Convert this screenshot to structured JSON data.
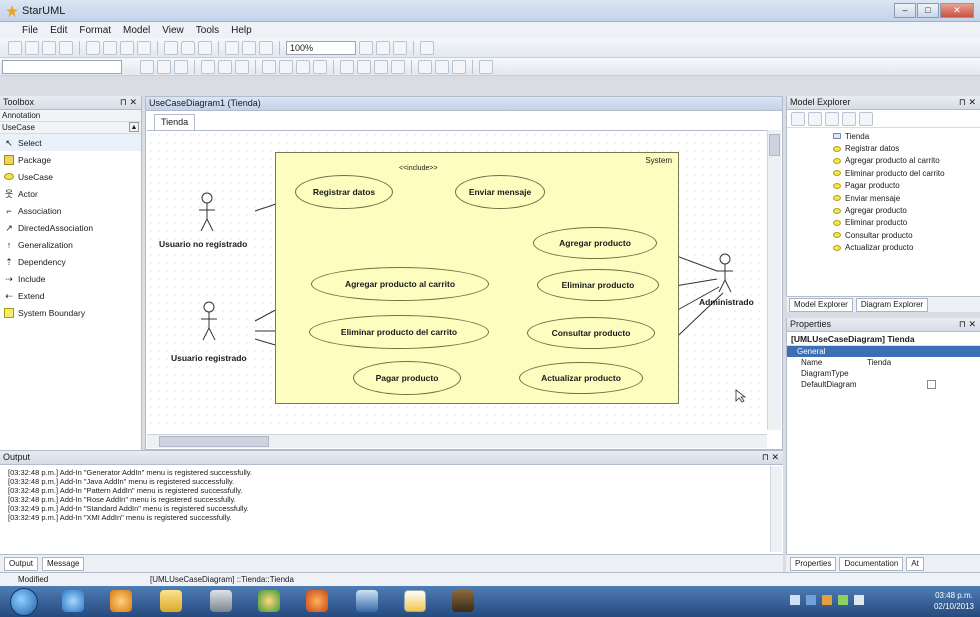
{
  "window": {
    "title": "StarUML"
  },
  "menu": [
    "File",
    "Edit",
    "Format",
    "Model",
    "View",
    "Tools",
    "Help"
  ],
  "toolbar": {
    "zoom": "100%"
  },
  "toolbox": {
    "title": "Toolbox",
    "sections": [
      "Annotation",
      "UseCase"
    ],
    "items": [
      "Select",
      "Package",
      "UseCase",
      "Actor",
      "Association",
      "DirectedAssociation",
      "Generalization",
      "Dependency",
      "Include",
      "Extend",
      "System Boundary"
    ]
  },
  "editor": {
    "title": "UseCaseDiagram1 (Tienda)",
    "tab": "Tienda",
    "diagram": {
      "system_label": "System",
      "stereotype": "<<include>>",
      "actors": [
        "Usuario no registrado",
        "Usuario registrado",
        "Administrado"
      ],
      "use_cases": [
        "Registrar datos",
        "Enviar mensaje",
        "Agregar producto al carrito",
        "Eliminar producto del carrito",
        "Pagar producto",
        "Agregar producto",
        "Eliminar producto",
        "Consultar producto",
        "Actualizar producto"
      ]
    }
  },
  "model_explorer": {
    "title": "Model Explorer",
    "items": [
      "Tienda",
      "Registrar datos",
      "Agregar producto al carrito",
      "Eliminar producto del carrito",
      "Pagar producto",
      "Enviar mensaje",
      "Agregar producto",
      "Eliminar producto",
      "Consultar producto",
      "Actualizar producto"
    ],
    "tabs": [
      "Model Explorer",
      "Diagram Explorer"
    ]
  },
  "properties": {
    "title": "Properties",
    "header": "[UMLUseCaseDiagram] Tienda",
    "group": "General",
    "rows": [
      {
        "name": "Name",
        "value": "Tienda"
      },
      {
        "name": "DiagramType",
        "value": ""
      },
      {
        "name": "DefaultDiagram",
        "value": ""
      }
    ]
  },
  "output": {
    "title": "Output",
    "lines": [
      "[03:32:48 p.m.] Add-In \"Generator AddIn\" menu is registered successfully.",
      "[03:32:48 p.m.] Add-In \"Java AddIn\" menu is registered successfully.",
      "[03:32:48 p.m.] Add-In \"Pattern AddIn\" menu is registered successfully.",
      "[03:32:48 p.m.] Add-In \"Rose AddIn\" menu is registered successfully.",
      "[03:32:49 p.m.] Add-In \"Standard AddIn\" menu is registered successfully.",
      "[03:32:49 p.m.] Add-In \"XMI AddIn\" menu is registered successfully."
    ]
  },
  "bottom_tabs": [
    "Output",
    "Message"
  ],
  "right_bottom_tabs": [
    "Properties",
    "Documentation",
    "At"
  ],
  "status": {
    "left": "Modified",
    "path": "[UMLUseCaseDiagram] ::Tienda::Tienda"
  },
  "clock": {
    "time": "03:48 p.m.",
    "date": "02/10/2013"
  }
}
